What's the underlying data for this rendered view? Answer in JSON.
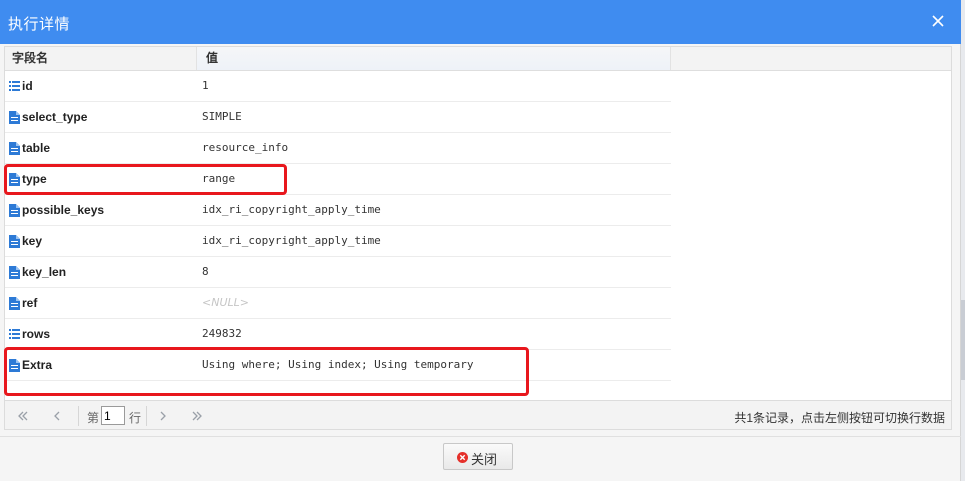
{
  "dialog": {
    "title": "执行详情",
    "close_icon": "close-icon"
  },
  "grid": {
    "headers": {
      "field": "字段名",
      "value": "值"
    },
    "rows": [
      {
        "field": "id",
        "value": "1",
        "icon": "list-icon"
      },
      {
        "field": "select_type",
        "value": "SIMPLE",
        "icon": "document-icon"
      },
      {
        "field": "table",
        "value": "resource_info",
        "icon": "document-icon"
      },
      {
        "field": "type",
        "value": "range",
        "icon": "document-icon"
      },
      {
        "field": "possible_keys",
        "value": "idx_ri_copyright_apply_time",
        "icon": "document-icon"
      },
      {
        "field": "key",
        "value": "idx_ri_copyright_apply_time",
        "icon": "document-icon"
      },
      {
        "field": "key_len",
        "value": "8",
        "icon": "list-icon"
      },
      {
        "field": "ref",
        "value": "<NULL>",
        "icon": "document-icon"
      },
      {
        "field": "rows",
        "value": "249832",
        "icon": "list-icon"
      },
      {
        "field": "Extra",
        "value": "Using where; Using index; Using temporary",
        "icon": "document-icon"
      }
    ]
  },
  "pager": {
    "page_prefix": "第",
    "page_value": "1",
    "page_suffix": "行",
    "info": "共1条记录，点击左侧按钮可切换行数据"
  },
  "footer": {
    "close_label": "关闭"
  },
  "colors": {
    "title_bar": "#3f8cf0",
    "highlight": "#e8171d",
    "icon_blue": "#2d7ad6"
  }
}
